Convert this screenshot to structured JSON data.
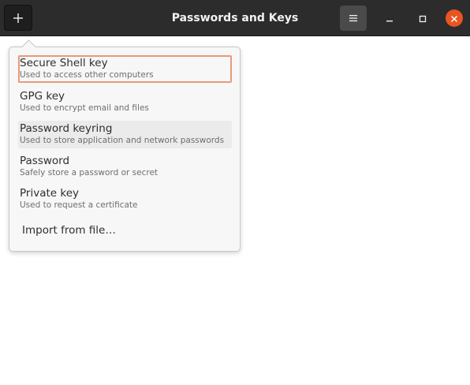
{
  "window": {
    "title": "Passwords and Keys"
  },
  "header": {
    "add_icon": "plus-icon",
    "menu_icon": "hamburger-menu-icon",
    "minimize_icon": "minimize-icon",
    "maximize_icon": "maximize-icon",
    "close_icon": "close-icon",
    "accent_color": "#e95420"
  },
  "popover": {
    "items": [
      {
        "title": "Secure Shell key",
        "subtitle": "Used to access other computers",
        "state": "focused"
      },
      {
        "title": "GPG key",
        "subtitle": "Used to encrypt email and files",
        "state": "normal"
      },
      {
        "title": "Password keyring",
        "subtitle": "Used to store application and network passwords",
        "state": "hovered"
      },
      {
        "title": "Password",
        "subtitle": "Safely store a password or secret",
        "state": "normal"
      },
      {
        "title": "Private key",
        "subtitle": "Used to request a certificate",
        "state": "normal"
      }
    ],
    "import_label": "Import from file…"
  }
}
